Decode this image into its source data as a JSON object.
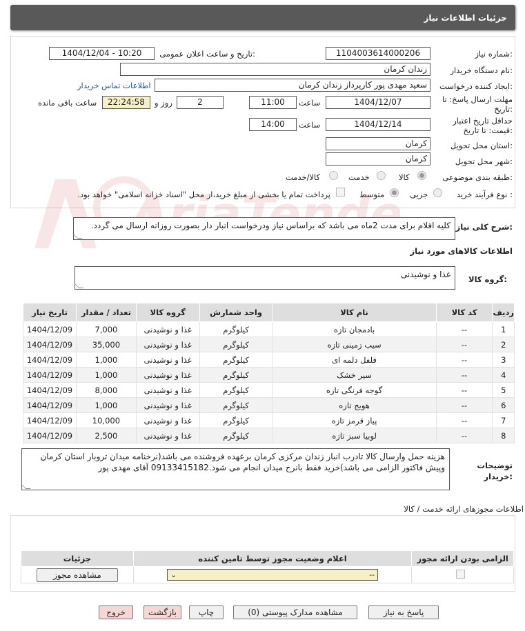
{
  "header": {
    "title": "جزئیات اطلاعات نیاز"
  },
  "form": {
    "need_number_label": "شماره نیاز:",
    "need_number": "1104003614000206",
    "announce_label": "تاریخ و ساعت اعلان عمومی:",
    "announce_value": "1404/12/04 - 10:20",
    "buyer_org_label": "نام دستگاه خریدار:",
    "buyer_org": "زندان کرمان",
    "requester_label": "ایجاد کننده درخواست:",
    "requester": "سعید مهدی پور کارپرداز زندان کرمان",
    "contact_link": "اطلاعات تماس خریدار",
    "deadline_label_1": "مهلت ارسال پاسخ: تا",
    "deadline_label_2": "تاریخ:",
    "deadline_date": "1404/12/07",
    "time_label": "ساعت",
    "deadline_time": "11:00",
    "days_value": "2",
    "days_label": "روز و",
    "remaining_time": "22:24:58",
    "remaining_label": "ساعت باقی مانده",
    "validity_label_1": "حداقل تاریخ اعتبار",
    "validity_label_2": "قیمت: تا تاریخ:",
    "validity_date": "1404/12/14",
    "validity_time": "14:00",
    "province_label": "استان محل تحویل:",
    "province": "کرمان",
    "city_label": "شهر محل تحویل:",
    "city": "کرمان",
    "category_label": "طبقه بندی موضوعی:",
    "category_options": [
      "کالا",
      "خدمت",
      "کالا/خدمت"
    ],
    "process_label": "نوع فرآیند خرید :",
    "process_options": [
      "جزیی",
      "متوسط"
    ],
    "treasury_text": "پرداخت تمام یا بخشی از مبلغ خرید،از محل \"اسناد خزانه اسلامی\" خواهد بود."
  },
  "description": {
    "label": "شرح کلی نیاز:",
    "text": "کلیه اقلام برای مدت 2ماه می باشد که براساس نیاز ودرخواست انبار دار بصورت روزانه ارسال می گردد."
  },
  "goods": {
    "section_title": "اطلاعات کالاهای مورد نیاز",
    "group_label": "گروه کالا:",
    "group_value": "غذا و نوشیدنی",
    "columns": [
      "ردیف",
      "کد کالا",
      "نام کالا",
      "واحد شمارش",
      "گروه کالا",
      "تعداد / مقدار",
      "تاریخ نیاز"
    ],
    "rows": [
      {
        "n": "1",
        "code": "--",
        "name": "بادمجان تازه",
        "unit": "کیلوگرم",
        "group": "غذا و نوشیدنی",
        "qty": "7,000",
        "date": "1404/12/09"
      },
      {
        "n": "2",
        "code": "--",
        "name": "سیب زمینی تازه",
        "unit": "کیلوگرم",
        "group": "غذا و نوشیدنی",
        "qty": "35,000",
        "date": "1404/12/09"
      },
      {
        "n": "3",
        "code": "--",
        "name": "فلفل دلمه ای",
        "unit": "کیلوگرم",
        "group": "غذا و نوشیدنی",
        "qty": "1,000",
        "date": "1404/12/09"
      },
      {
        "n": "4",
        "code": "--",
        "name": "سیر خشک",
        "unit": "کیلوگرم",
        "group": "غذا و نوشیدنی",
        "qty": "1,000",
        "date": "1404/12/09"
      },
      {
        "n": "5",
        "code": "--",
        "name": "گوجه فرنگی تازه",
        "unit": "کیلوگرم",
        "group": "غذا و نوشیدنی",
        "qty": "8,000",
        "date": "1404/12/09"
      },
      {
        "n": "6",
        "code": "--",
        "name": "هویج تازه",
        "unit": "کیلوگرم",
        "group": "غذا و نوشیدنی",
        "qty": "1,000",
        "date": "1404/12/09"
      },
      {
        "n": "7",
        "code": "--",
        "name": "پیاز قرمز تازه",
        "unit": "کیلوگرم",
        "group": "غذا و نوشیدنی",
        "qty": "10,000",
        "date": "1404/12/09"
      },
      {
        "n": "8",
        "code": "--",
        "name": "لوبیا سبز تازه",
        "unit": "کیلوگرم",
        "group": "غذا و نوشیدنی",
        "qty": "2,500",
        "date": "1404/12/09"
      }
    ]
  },
  "buyer_notes": {
    "label_1": "توضیحات",
    "label_2": "خریدار:",
    "text": "هزینه حمل وارسال کالا تادرب انبار زندان مرکزی کرمان برعهده فروشنده می باشد(نرخنامه میدان تروبار استان کرمان وپیش فاکتور الزامی می باشد)خرید فقط بانرخ میدان انجام می شود.09133415182 آقای مهدی پور"
  },
  "licenses": {
    "section_title": "اطلاعات مجوزهای ارائه خدمت / کالا",
    "columns": [
      "الزامی بودن ارائه مجوز",
      "اعلام وضعیت مجوز توسط تامین کننده",
      "جزئیات"
    ],
    "select_value": "--",
    "view_button": "مشاهده مجوز"
  },
  "actions": {
    "respond": "پاسخ به نیاز",
    "attachments": "مشاهده مدارک پیوستی (0)",
    "print": "چاپ",
    "back": "بازگشت",
    "exit": "خروج"
  },
  "watermark": {
    "text": "AriaTender.net"
  },
  "colors": {
    "header_bg": "#595959",
    "link": "#2255aa",
    "highlight": "#f5f0c8",
    "danger_btn": "#f7d6d6"
  }
}
